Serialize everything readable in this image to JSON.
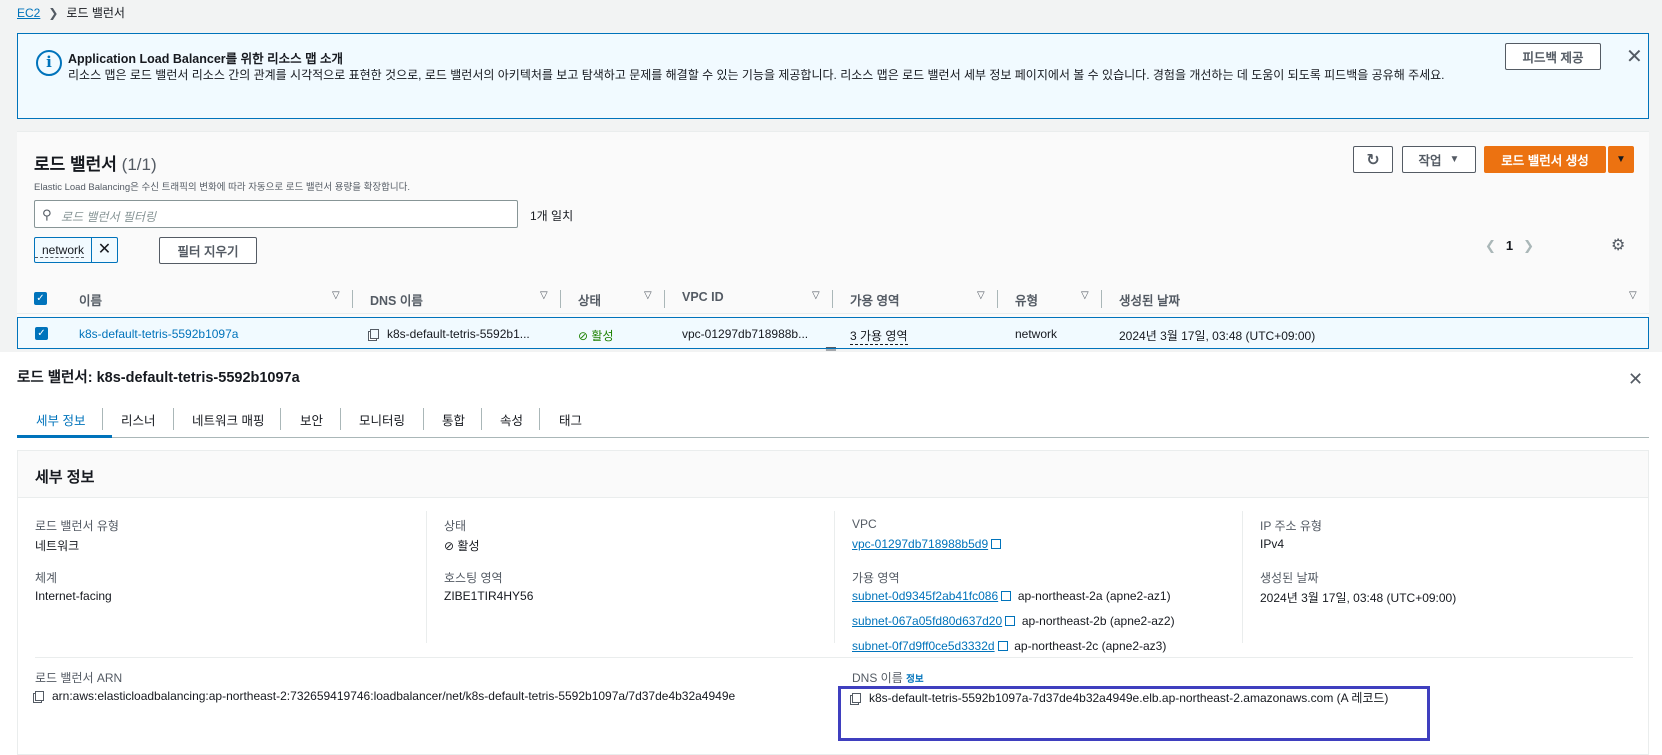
{
  "breadcrumb": {
    "root": "EC2",
    "current": "로드 밸런서"
  },
  "banner": {
    "title": "Application Load Balancer를 위한 리소스 맵 소개",
    "desc": "리소스 맵은 로드 밸런서 리소스 간의 관계를 시각적으로 표현한 것으로, 로드 밸런서의 아키텍처를 보고 탐색하고 문제를 해결할 수 있는 기능을 제공합니다. 리소스 맵은 로드 밸런서 세부 정보 페이지에서 볼 수 있습니다. 경험을 개선하는 데 도움이 되도록 피드백을 공유해 주세요.",
    "feedback_btn": "피드백 제공"
  },
  "list": {
    "title": "로드 밸런서",
    "count": "(1/1)",
    "desc": "Elastic Load Balancing은 수신 트래픽의 변화에 따라 자동으로 로드 밸런서 용량을 확장합니다.",
    "actions_btn": "작업",
    "create_btn": "로드 밸런서 생성",
    "search_placeholder": "로드 밸런서 필터링",
    "match_text": "1개 일치",
    "filter_token": "network",
    "clear_filter_btn": "필터 지우기",
    "page": "1",
    "columns": [
      "이름",
      "DNS 이름",
      "상태",
      "VPC ID",
      "가용 영역",
      "유형",
      "생성된 날짜"
    ],
    "row": {
      "name": "k8s-default-tetris-5592b1097a",
      "dns": "k8s-default-tetris-5592b1...",
      "state": "활성",
      "vpc": "vpc-01297db718988b...",
      "az": "3 가용 영역",
      "type": "network",
      "created": "2024년 3월 17일, 03:48 (UTC+09:00)"
    }
  },
  "detail": {
    "title": "로드 밸런서: k8s-default-tetris-5592b1097a",
    "tabs": [
      "세부 정보",
      "리스너",
      "네트워크 매핑",
      "보안",
      "모니터링",
      "통합",
      "속성",
      "태그"
    ],
    "section_title": "세부 정보",
    "lb_type_label": "로드 밸런서 유형",
    "lb_type": "네트워크",
    "scheme_label": "체계",
    "scheme": "Internet-facing",
    "state_label": "상태",
    "state": "활성",
    "hosted_zone_label": "호스팅 영역",
    "hosted_zone": "ZIBE1TIR4HY56",
    "vpc_label": "VPC",
    "vpc": "vpc-01297db718988b5d9",
    "az_label": "가용 영역",
    "subnets": [
      {
        "id": "subnet-0d9345f2ab41fc086",
        "zone": "ap-northeast-2a (apne2-az1)"
      },
      {
        "id": "subnet-067a05fd80d637d20",
        "zone": "ap-northeast-2b (apne2-az2)"
      },
      {
        "id": "subnet-0f7d9ff0ce5d3332d",
        "zone": "ap-northeast-2c (apne2-az3)"
      }
    ],
    "ip_type_label": "IP 주소 유형",
    "ip_type": "IPv4",
    "created_label": "생성된 날짜",
    "created": "2024년 3월 17일, 03:48 (UTC+09:00)",
    "arn_label": "로드 밸런서 ARN",
    "arn": "arn:aws:elasticloadbalancing:ap-northeast-2:732659419746:loadbalancer/net/k8s-default-tetris-5592b1097a/7d37de4b32a4949e",
    "dns_label": "DNS 이름",
    "dns_info": "정보",
    "dns": "k8s-default-tetris-5592b1097a-7d37de4b32a4949e.elb.ap-northeast-2.amazonaws.com (A 레코드)"
  }
}
